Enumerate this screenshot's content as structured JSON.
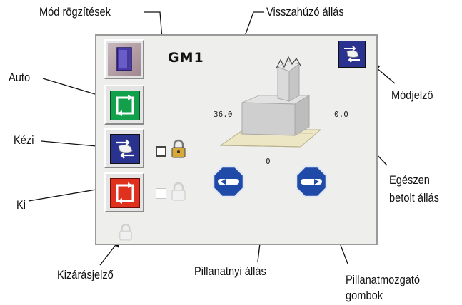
{
  "callouts": {
    "mod_rogzitesek": "Mód rögzítések",
    "visszahuzo_allas": "Visszahúzó állás",
    "auto": "Auto",
    "modjelzo": "Módjelző",
    "kezi": "Kézi",
    "egeszen_line1": "Egészen",
    "egeszen_line2": "betolt állás",
    "ki": "Ki",
    "kizarasjelzo": "Kizárásjelző",
    "pillanatnyi_allas": "Pillanatnyi állás",
    "pillanatmozgato_line1": "Pillanatmozgató",
    "pillanatmozgato_line2": "gombok"
  },
  "panel": {
    "title": "GM1",
    "retract_value": "36.0",
    "full_value": "0.0",
    "current_value": "0"
  },
  "colors": {
    "auto": "#12a04a",
    "manual": "#2a3290",
    "off": "#e0301e",
    "jog": "#1f4aa8",
    "book": "#4a3aa8"
  },
  "icons": {
    "book": "book-icon",
    "auto": "auto-cycle-icon",
    "manual": "manual-hand-icon",
    "off": "off-cycle-icon",
    "lock": "padlock-icon",
    "jog_left": "arrow-left-icon",
    "jog_right": "arrow-right-icon"
  }
}
